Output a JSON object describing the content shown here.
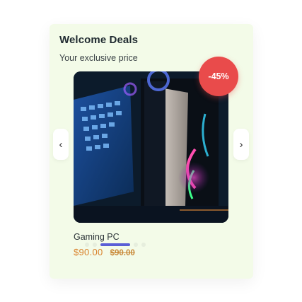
{
  "deals": {
    "title": "Welcome Deals",
    "subtitle": "Your exclusive price"
  },
  "product": {
    "name": "Gaming PC",
    "price": "$90.00",
    "original_price": "$90.00",
    "discount_badge": "-45%",
    "image_icon": "gaming-pc-image"
  },
  "carousel": {
    "prev_label": "‹",
    "next_label": "›",
    "dot_count": 5,
    "active_dot": 2
  },
  "colors": {
    "card_background": "#f3fbe8",
    "badge": "#e94b4b",
    "price": "#d9822b",
    "active_dot": "#5a5fd6"
  }
}
